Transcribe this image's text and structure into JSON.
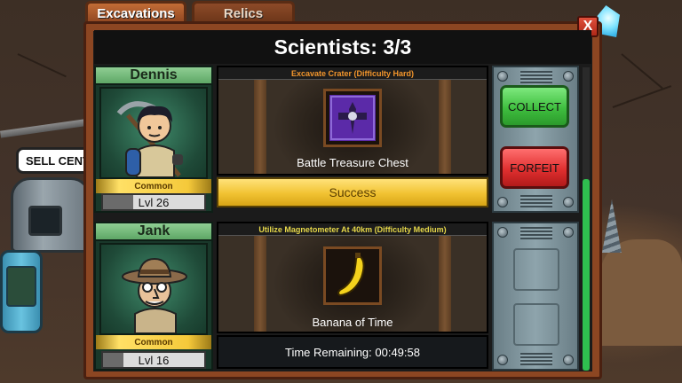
{
  "tabs": [
    {
      "label": "Excavations",
      "active": true
    },
    {
      "label": "Relics",
      "active": false
    }
  ],
  "background": {
    "sell_sign": "SELL CENT"
  },
  "header": {
    "title": "Scientists: 3/3",
    "close_label": "X"
  },
  "colors": {
    "mission_hard": "#f3962c",
    "mission_medium": "#e6d84a",
    "collect": "#3fbf3f",
    "forfeit": "#e03030",
    "success": "#f1c232"
  },
  "expeditions": [
    {
      "scientist": {
        "name": "Dennis",
        "rarity": "Common",
        "level_label": "Lvl 26",
        "xp_fraction": 0.3
      },
      "mission_title": "Excavate Crater (Difficulty Hard)",
      "reward": {
        "name": "Battle Treasure Chest",
        "icon": "battle-treasure-chest-icon"
      },
      "status": "Success",
      "actions": {
        "collect_label": "COLLECT",
        "forfeit_label": "FORFEIT"
      }
    },
    {
      "scientist": {
        "name": "Jank",
        "rarity": "Common",
        "level_label": "Lvl 16",
        "xp_fraction": 0.2
      },
      "mission_title": "Utilize Magnetometer At 40km (Difficulty Medium)",
      "reward": {
        "name": "Banana of Time",
        "icon": "banana-icon"
      },
      "status": "Time Remaining: 00:49:58"
    }
  ]
}
